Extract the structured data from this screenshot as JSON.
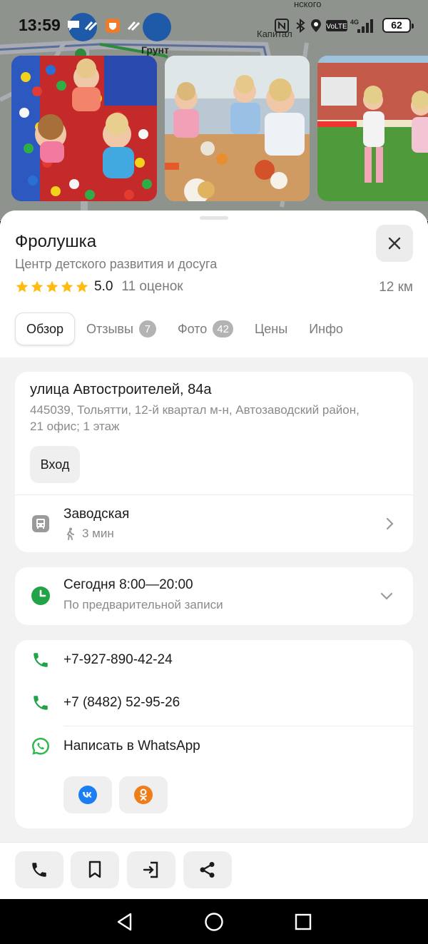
{
  "status_bar": {
    "time": "13:59",
    "battery": "62",
    "icons": [
      "chat-bubble-icon",
      "app-icon",
      "shield-app-icon",
      "app-icon",
      "nfc-icon",
      "bluetooth-icon",
      "location-icon",
      "volte-icon",
      "signal-4g-icon",
      "battery-icon"
    ]
  },
  "map": {
    "labels": [
      "Грунт",
      "Капитал",
      "нского"
    ]
  },
  "place": {
    "name": "Фролушка",
    "category": "Центр детского развития и досуга",
    "rating": "5.0",
    "rating_count": "11 оценок",
    "distance": "12 км",
    "stars_filled": 5
  },
  "tabs": [
    {
      "label": "Обзор",
      "badge": null,
      "active": true
    },
    {
      "label": "Отзывы",
      "badge": "7",
      "active": false
    },
    {
      "label": "Фото",
      "badge": "42",
      "active": false
    },
    {
      "label": "Цены",
      "badge": null,
      "active": false
    },
    {
      "label": "Инфо",
      "badge": null,
      "active": false
    }
  ],
  "address": {
    "main": "улица Автостроителей, 84а",
    "detail": "445039, Тольятти, 12-й квартал м-н, Автозаводский район, 21 офис; 1 этаж",
    "entrance_label": "Вход"
  },
  "transit": {
    "stop": "Заводская",
    "walk_time": "3 мин"
  },
  "hours": {
    "today": "Сегодня 8:00—20:00",
    "note": "По предварительной записи"
  },
  "contacts": {
    "phone1": "+7-927-890-42-24",
    "phone2": "+7 (8482) 52-95-26",
    "whatsapp": "Написать в WhatsApp"
  },
  "colors": {
    "star": "#ffbb10",
    "green": "#22a348",
    "vk": "#1b7ef2",
    "ok": "#ef7d1a",
    "whatsapp": "#2fb84d"
  }
}
